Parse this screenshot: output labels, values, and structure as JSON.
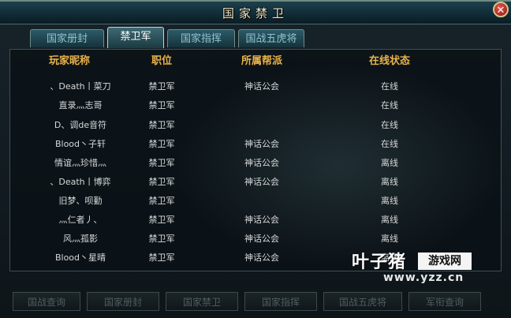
{
  "window": {
    "title": "国家禁卫",
    "close_label": "✕"
  },
  "tabs": [
    {
      "label": "国家册封",
      "active": false
    },
    {
      "label": "禁卫军",
      "active": true
    },
    {
      "label": "国家指挥",
      "active": false
    },
    {
      "label": "国战五虎将",
      "active": false
    }
  ],
  "table": {
    "headers": [
      "玩家昵称",
      "职位",
      "所属帮派",
      "在线状态"
    ],
    "rows": [
      {
        "name": "、Death丨菜刀",
        "position": "禁卫军",
        "guild": "神话公会",
        "status": "在线"
      },
      {
        "name": "直录灬志哥",
        "position": "禁卫军",
        "guild": "",
        "status": "在线"
      },
      {
        "name": "D、调de音符",
        "position": "禁卫军",
        "guild": "",
        "status": "在线"
      },
      {
        "name": "Blood丶子轩",
        "position": "禁卫军",
        "guild": "神话公会",
        "status": "在线"
      },
      {
        "name": "情谊灬珍惜灬",
        "position": "禁卫军",
        "guild": "神话公会",
        "status": "离线"
      },
      {
        "name": "、Death丨博弈",
        "position": "禁卫军",
        "guild": "神话公会",
        "status": "离线"
      },
      {
        "name": "旧梦、呗勤",
        "position": "禁卫军",
        "guild": "",
        "status": "离线"
      },
      {
        "name": "灬仁者丿、",
        "position": "禁卫军",
        "guild": "神话公会",
        "status": "离线"
      },
      {
        "name": "风灬孤影",
        "position": "禁卫军",
        "guild": "神话公会",
        "status": "离线"
      },
      {
        "name": "Blood丶星晴",
        "position": "禁卫军",
        "guild": "神话公会",
        "status": "离线"
      }
    ]
  },
  "bottom_buttons": [
    "国战查询",
    "国家册封",
    "国家禁卫",
    "国家指挥",
    "国战五虎将",
    "军衔查询"
  ],
  "watermark": {
    "logo": "叶子猪",
    "box": "游戏网",
    "url": "www.yzz.cn"
  },
  "colors": {
    "header": "#e9b24a",
    "cell_text": "#d8d8d8",
    "tab_active": "#ffffff",
    "tab_inactive": "#8fc4d2"
  }
}
